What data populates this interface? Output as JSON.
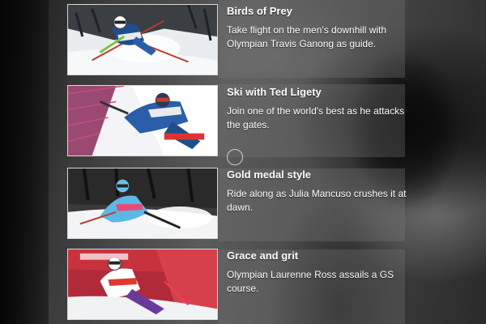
{
  "stories": [
    {
      "title": "Birds of Prey",
      "description": "Take flight on the men's downhill with Olympian Travis Ganong as guide.",
      "image_icon": "skier-downhill-image"
    },
    {
      "title": "Ski with Ted Ligety",
      "description": "Join one of the world's best as he attacks the gates.",
      "image_icon": "skier-giant-slalom-image"
    },
    {
      "title": "Gold medal style",
      "description": "Ride along as Julia Mancuso crushes it at dawn.",
      "image_icon": "skier-super-g-image"
    },
    {
      "title": "Grace and grit",
      "description": "Olympian Laurenne Ross assails a GS course.",
      "image_icon": "skier-gs-course-image"
    }
  ],
  "colors": {
    "text": "#ffffff",
    "panel": "rgba(120,120,120,0.32)",
    "background": "#2b2b2b"
  }
}
